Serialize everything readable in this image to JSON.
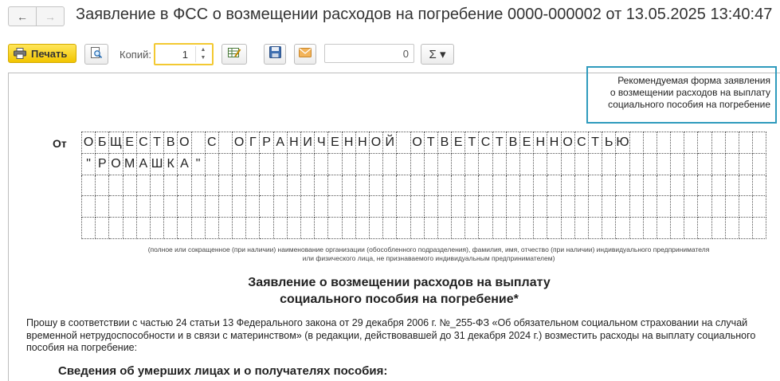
{
  "window": {
    "title": "Заявление в ФСС о возмещении расходов на погребение 0000-000002 от 13.05.2025 13:40:47",
    "back_glyph": "←",
    "forward_glyph": "→"
  },
  "toolbar": {
    "print_label": "Печать",
    "copies_label": "Копий:",
    "copies_value": "1",
    "sum_value": "0",
    "sigma_label": "Σ ▾",
    "accent_color": "#f2c500"
  },
  "document": {
    "recommended_lines": [
      "Рекомендуемая форма заявления",
      "о возмещении расходов на выплату",
      "социального пособия на погребение"
    ],
    "from_label": "От",
    "grid_rows": [
      "ОБЩЕСТВО С ОГРАНИЧЕННОЙ ОТВЕТСТВЕННОСТЬЮ",
      "\"РОМАШКА\"",
      "",
      "",
      ""
    ],
    "grid_note_lines": [
      "(полное или сокращенное (при наличии) наименование организации (обособленного подразделения), фамилия, имя, отчество (при наличии) индивидуального предпринимателя",
      "или физического лица, не признаваемого индивидуальным предпринимателем)"
    ],
    "heading_lines": [
      "Заявление о возмещении расходов на выплату",
      "социального пособия на погребение*"
    ],
    "paragraph": "Прошу в соответствии с частью 24 статьи 13 Федерального закона от 29 декабря 2006 г. №_255-ФЗ «Об обязательном социальном страховании на случай временной нетрудоспособности и в связи с материнством» (в редакции, действовавшей до 31 декабря 2024 г.) возместить расходы на выплату социального пособия на погребение:",
    "subheading": "Сведения об умерших лицах и о получателях пособия:",
    "box_color": "#2f9bbd"
  },
  "icons": [
    "back-arrow-icon",
    "forward-arrow-icon",
    "printer-icon",
    "preview-icon",
    "edit-table-icon",
    "save-icon",
    "mail-icon",
    "sigma-icon"
  ]
}
